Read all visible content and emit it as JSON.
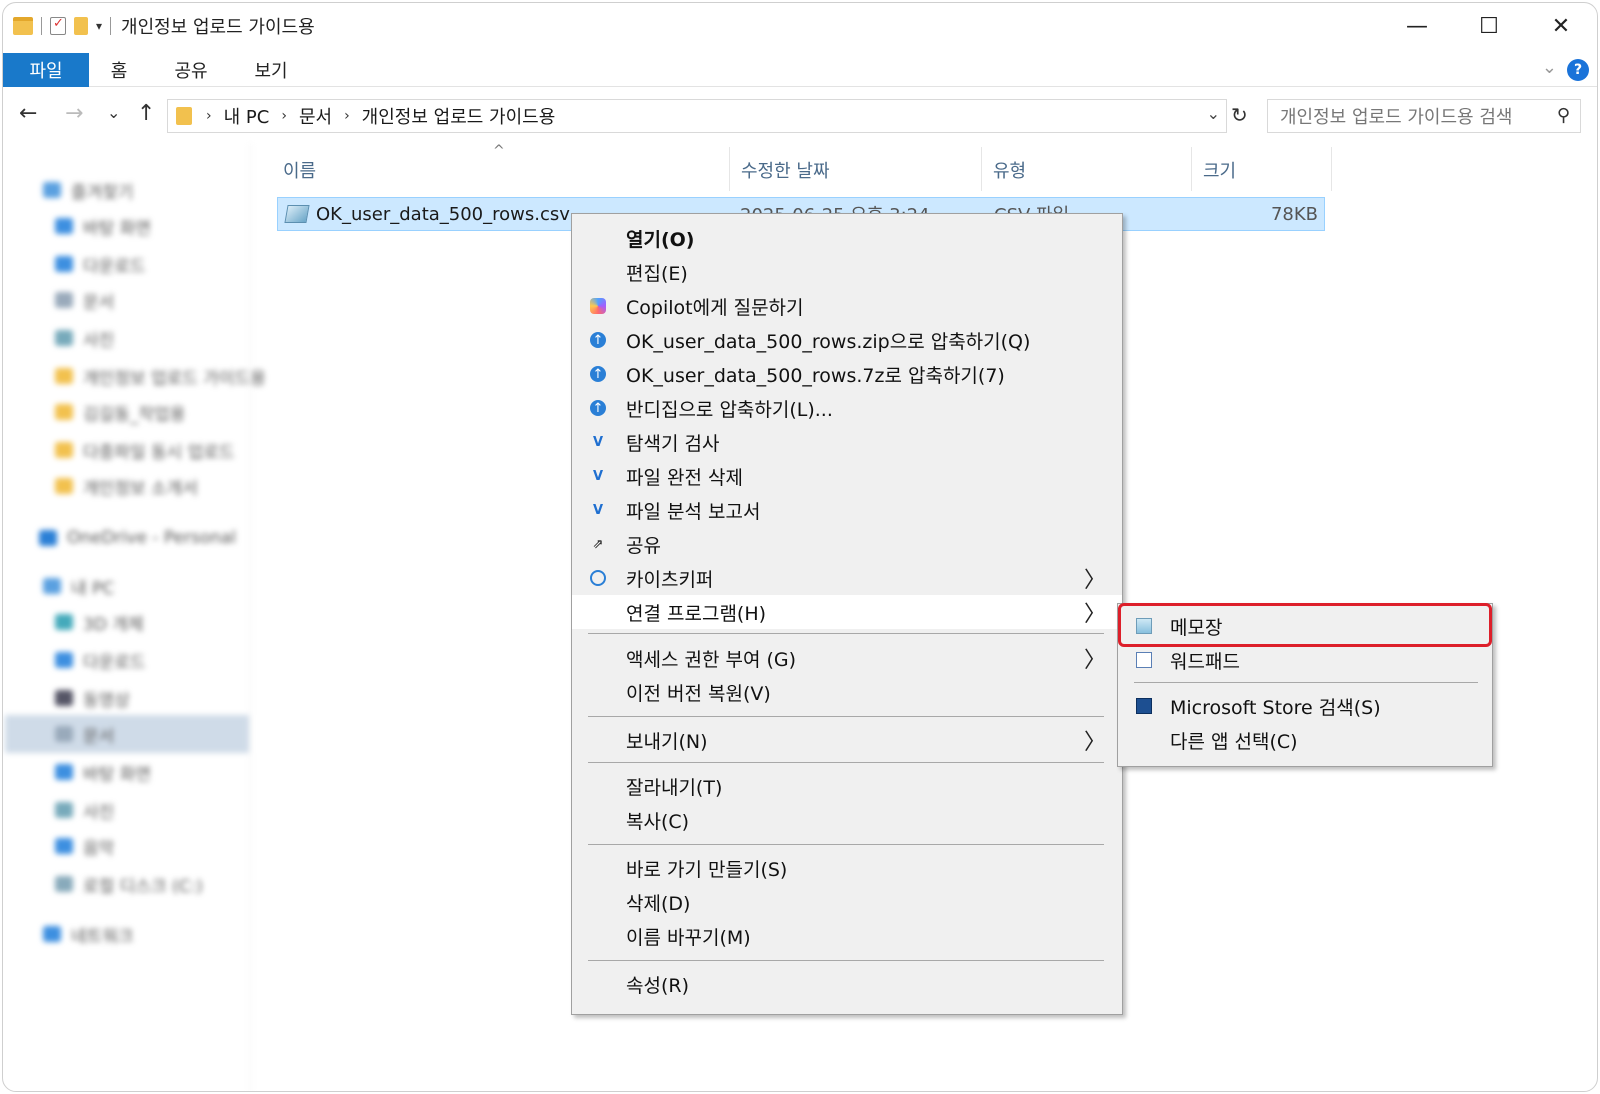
{
  "window": {
    "title": "개인정보 업로드 가이드용",
    "controls": {
      "minimize": "—",
      "maximize": "☐",
      "close": "✕"
    }
  },
  "ribbon": {
    "tabs": [
      "파일",
      "홈",
      "공유",
      "보기"
    ],
    "help_icon": "?"
  },
  "nav": {
    "back": "←",
    "forward": "→",
    "recent": "⌄",
    "up": "↑",
    "breadcrumb": [
      "내 PC",
      "문서",
      "개인정보 업로드 가이드용"
    ],
    "refresh": "↻",
    "search_placeholder": "개인정보 업로드 가이드용 검색",
    "search_icon": "⚲"
  },
  "sidebar": {
    "items": [
      "즐겨찾기",
      "바탕 화면",
      "다운로드",
      "문서",
      "사진",
      "개인정보 업로드 가이드용",
      "김길동_작업용",
      "다중파일 동시 업로드",
      "개인정보 소개서",
      "OneDrive - Personal",
      "내 PC",
      "3D 개체",
      "다운로드",
      "동영상",
      "문서",
      "바탕 화면",
      "사진",
      "음악",
      "로컬 디스크 (C:)",
      "네트워크"
    ]
  },
  "columns": [
    "이름",
    "수정한 날짜",
    "유형",
    "크기"
  ],
  "file": {
    "name": "OK_user_data_500_rows.csv",
    "date": "2025-06-25 오후 3:24",
    "type": "CSV 파일",
    "size": "78KB"
  },
  "context_menu": {
    "items": [
      {
        "label": "열기(O)",
        "icon": ""
      },
      {
        "label": "편집(E)",
        "icon": ""
      },
      {
        "label": "Copilot에게 질문하기",
        "icon": "copilot-icon"
      },
      {
        "label": "OK_user_data_500_rows.zip으로 압축하기(Q)",
        "icon": "bandizip-icon"
      },
      {
        "label": "OK_user_data_500_rows.7z로 압축하기(7)",
        "icon": "bandizip-icon"
      },
      {
        "label": "반디집으로 압축하기(L)...",
        "icon": "bandizip-icon"
      },
      {
        "label": "탐색기 검사",
        "icon": "v3-icon"
      },
      {
        "label": "파일 완전 삭제",
        "icon": "v3-icon"
      },
      {
        "label": "파일 분석 보고서",
        "icon": "v3-icon"
      },
      {
        "label": "공유",
        "icon": "share-icon"
      },
      {
        "label": "카이츠키퍼",
        "icon": "kaitskeeper-icon"
      },
      {
        "label": "연결 프로그램(H)",
        "icon": ""
      },
      {
        "label": "액세스 권한 부여 (G)",
        "icon": ""
      },
      {
        "label": "이전 버전 복원(V)",
        "icon": ""
      },
      {
        "label": "보내기(N)",
        "icon": ""
      },
      {
        "label": "잘라내기(T)",
        "icon": ""
      },
      {
        "label": "복사(C)",
        "icon": ""
      },
      {
        "label": "바로 가기 만들기(S)",
        "icon": ""
      },
      {
        "label": "삭제(D)",
        "icon": ""
      },
      {
        "label": "이름 바꾸기(M)",
        "icon": ""
      },
      {
        "label": "속성(R)",
        "icon": ""
      }
    ],
    "submenu_arrow": "〉"
  },
  "open_with_submenu": {
    "items": [
      {
        "label": "메모장",
        "icon": "notepad-icon"
      },
      {
        "label": "워드패드",
        "icon": "wordpad-icon"
      },
      {
        "label": "Microsoft Store 검색(S)",
        "icon": "store-icon"
      },
      {
        "label": "다른 앱 선택(C)",
        "icon": ""
      }
    ],
    "highlight_color": "#dd1f2a"
  }
}
